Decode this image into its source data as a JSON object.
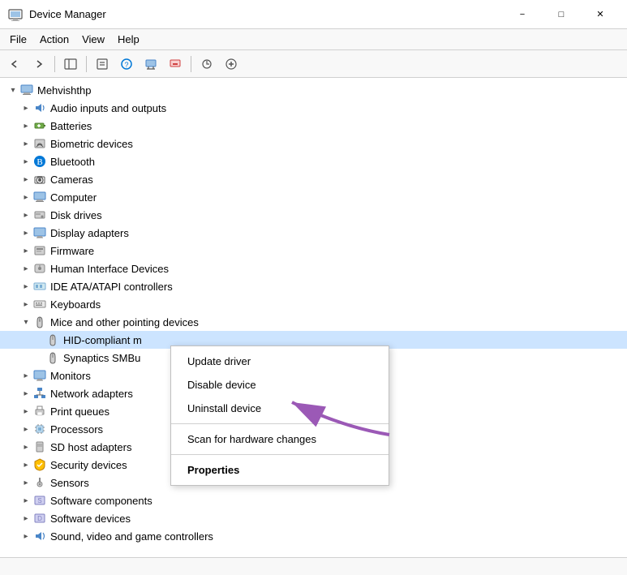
{
  "titleBar": {
    "icon": "device-manager-icon",
    "title": "Device Manager"
  },
  "menuBar": {
    "items": [
      "File",
      "Action",
      "View",
      "Help"
    ]
  },
  "toolbar": {
    "buttons": [
      "back",
      "forward",
      "show-hide-pane",
      "properties",
      "help",
      "update-driver",
      "uninstall",
      "scan-changes",
      "add-hardware"
    ]
  },
  "tree": {
    "rootLabel": "Mehvishthp",
    "items": [
      {
        "id": "audio",
        "label": "Audio inputs and outputs",
        "indent": 2,
        "expanded": false
      },
      {
        "id": "batteries",
        "label": "Batteries",
        "indent": 2,
        "expanded": false
      },
      {
        "id": "biometric",
        "label": "Biometric devices",
        "indent": 2,
        "expanded": false
      },
      {
        "id": "bluetooth",
        "label": "Bluetooth",
        "indent": 2,
        "expanded": false
      },
      {
        "id": "cameras",
        "label": "Cameras",
        "indent": 2,
        "expanded": false
      },
      {
        "id": "computer",
        "label": "Computer",
        "indent": 2,
        "expanded": false
      },
      {
        "id": "disk",
        "label": "Disk drives",
        "indent": 2,
        "expanded": false
      },
      {
        "id": "display",
        "label": "Display adapters",
        "indent": 2,
        "expanded": false
      },
      {
        "id": "firmware",
        "label": "Firmware",
        "indent": 2,
        "expanded": false
      },
      {
        "id": "hid",
        "label": "Human Interface Devices",
        "indent": 2,
        "expanded": false
      },
      {
        "id": "ide",
        "label": "IDE ATA/ATAPI controllers",
        "indent": 2,
        "expanded": false
      },
      {
        "id": "keyboards",
        "label": "Keyboards",
        "indent": 2,
        "expanded": false
      },
      {
        "id": "mice",
        "label": "Mice and other pointing devices",
        "indent": 2,
        "expanded": true
      },
      {
        "id": "hid-mouse",
        "label": "HID-compliant m",
        "indent": 3,
        "selected": true
      },
      {
        "id": "synaptics",
        "label": "Synaptics SMBu",
        "indent": 3
      },
      {
        "id": "monitors",
        "label": "Monitors",
        "indent": 2,
        "expanded": false
      },
      {
        "id": "network",
        "label": "Network adapters",
        "indent": 2,
        "expanded": false
      },
      {
        "id": "print",
        "label": "Print queues",
        "indent": 2,
        "expanded": false
      },
      {
        "id": "processors",
        "label": "Processors",
        "indent": 2,
        "expanded": false
      },
      {
        "id": "sd",
        "label": "SD host adapters",
        "indent": 2,
        "expanded": false
      },
      {
        "id": "security",
        "label": "Security devices",
        "indent": 2,
        "expanded": false
      },
      {
        "id": "sensors",
        "label": "Sensors",
        "indent": 2,
        "expanded": false
      },
      {
        "id": "software-comp",
        "label": "Software components",
        "indent": 2,
        "expanded": false
      },
      {
        "id": "software-dev",
        "label": "Software devices",
        "indent": 2,
        "expanded": false
      },
      {
        "id": "sound",
        "label": "Sound, video and game controllers",
        "indent": 2,
        "expanded": false
      }
    ]
  },
  "contextMenu": {
    "items": [
      {
        "id": "update-driver",
        "label": "Update driver",
        "bold": false
      },
      {
        "id": "disable-device",
        "label": "Disable device",
        "bold": false
      },
      {
        "id": "uninstall-device",
        "label": "Uninstall device",
        "bold": false
      },
      {
        "id": "sep1",
        "type": "separator"
      },
      {
        "id": "scan-hardware",
        "label": "Scan for hardware changes",
        "bold": false
      },
      {
        "id": "sep2",
        "type": "separator"
      },
      {
        "id": "properties",
        "label": "Properties",
        "bold": true
      }
    ]
  },
  "statusBar": {
    "text": ""
  }
}
